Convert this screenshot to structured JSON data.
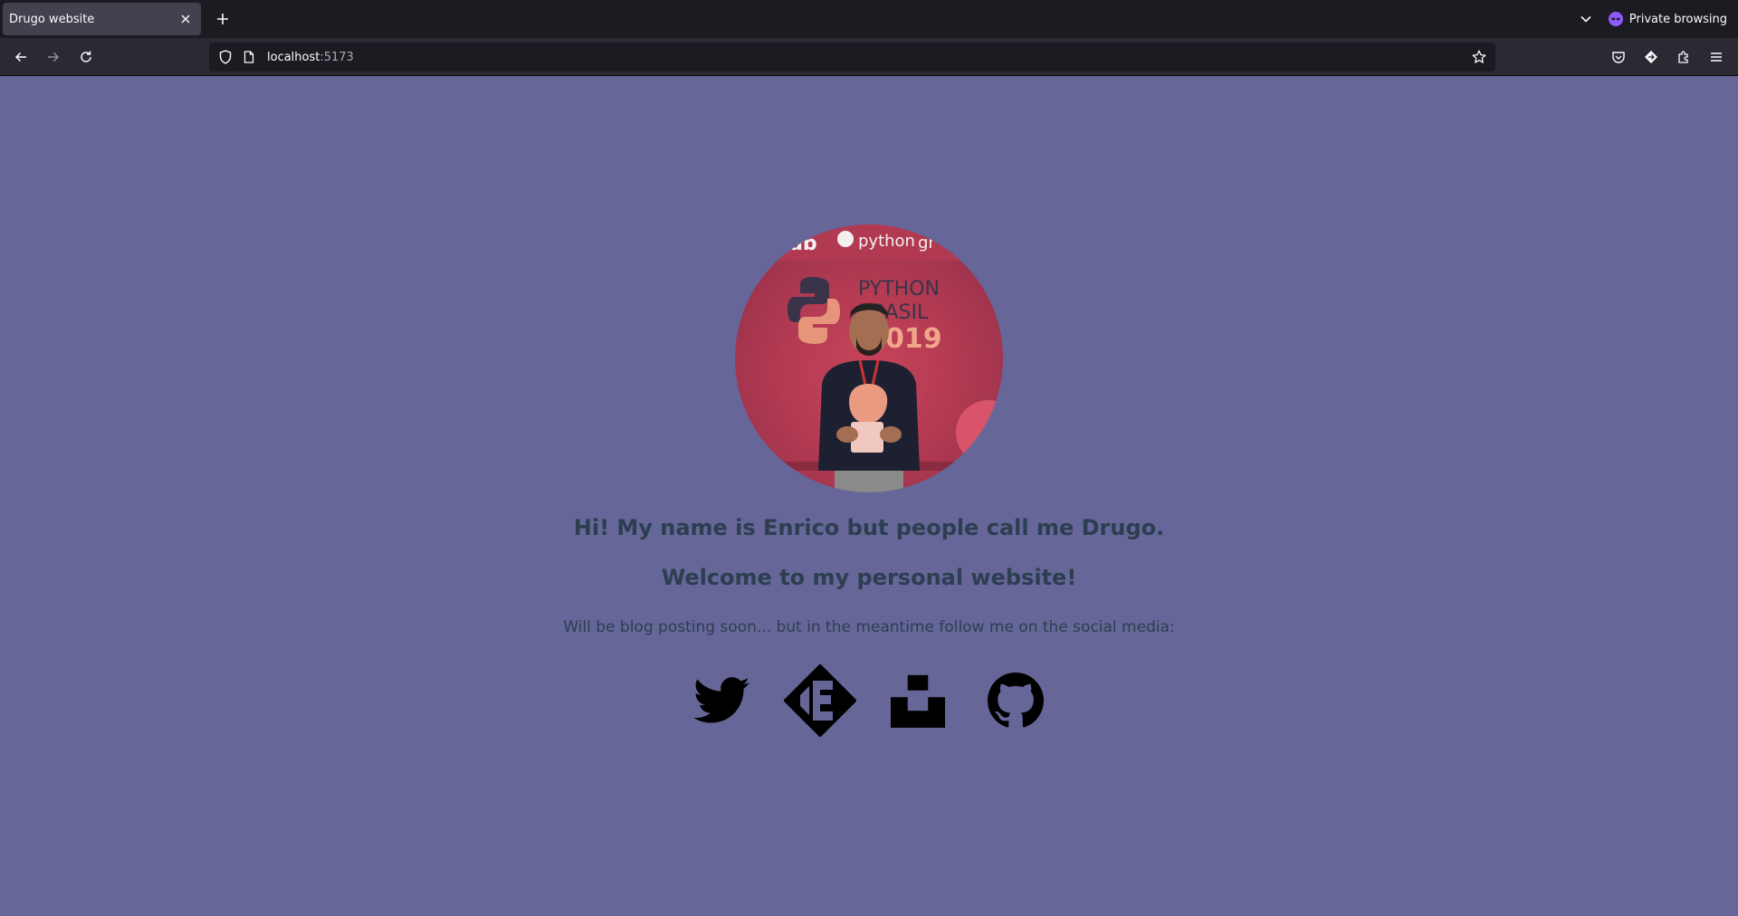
{
  "browser": {
    "tab_title": "Drugo website",
    "private_label": "Private browsing",
    "url_host": "localhost",
    "url_port": ":5173",
    "colors": {
      "tabbar_bg": "#1c1b22",
      "toolbar_bg": "#2b2a33",
      "private_accent": "#9059ff"
    }
  },
  "page": {
    "background": "#666698",
    "avatar_alt": "Profile photo at Python Brasil 2019",
    "avatar_banner_text": "PYTHON BRASIL 2019",
    "avatar_logo_text": "python",
    "heading_1": "Hi! My name is Enrico but people call me Drugo.",
    "heading_2": "Welcome to my personal website!",
    "description": "Will be blog posting soon... but in the meantime follow me on the social media:",
    "social_links": [
      {
        "name": "twitter",
        "icon": "twitter-icon"
      },
      {
        "name": "letterboxd-style",
        "icon": "diamond-logo-icon"
      },
      {
        "name": "unsplash",
        "icon": "unsplash-icon"
      },
      {
        "name": "github",
        "icon": "github-icon"
      }
    ]
  }
}
